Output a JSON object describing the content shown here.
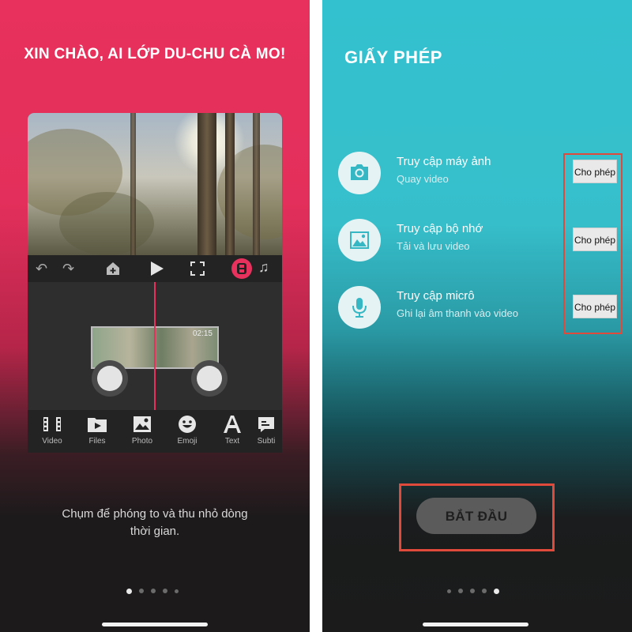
{
  "left": {
    "title": "XIN CHÀO, AI LỚP DU-CHU CÀ MO!",
    "clip_time": "02:15",
    "tools": [
      {
        "label": "Video",
        "icon": "film-icon"
      },
      {
        "label": "Files",
        "icon": "folder-play-icon"
      },
      {
        "label": "Photo",
        "icon": "image-icon"
      },
      {
        "label": "Emoji",
        "icon": "emoji-icon"
      },
      {
        "label": "Text",
        "icon": "text-icon"
      },
      {
        "label": "Subti",
        "icon": "subtitle-icon"
      }
    ],
    "caption_line1": "Chụm để phóng to và thu nhỏ dòng",
    "caption_line2": "thời gian.",
    "page_index": 0,
    "page_count": 5
  },
  "right": {
    "title": "GIẤY PHÉP",
    "permissions": [
      {
        "title": "Truy cập máy ảnh",
        "subtitle": "Quay video",
        "button": "Cho phép",
        "icon": "camera-icon"
      },
      {
        "title": "Truy cập bộ nhớ",
        "subtitle": "Tải và lưu video",
        "button": "Cho phép",
        "icon": "photo-library-icon"
      },
      {
        "title": "Truy cập micrô",
        "subtitle": "Ghi lại âm thanh vào video",
        "button": "Cho phép",
        "icon": "microphone-icon"
      }
    ],
    "start_button": "BẮT ĐẦU",
    "page_index": 4,
    "page_count": 5
  },
  "colors": {
    "left_accent": "#e8315d",
    "right_accent": "#34c1cf",
    "highlight_box": "#e04a3b"
  }
}
